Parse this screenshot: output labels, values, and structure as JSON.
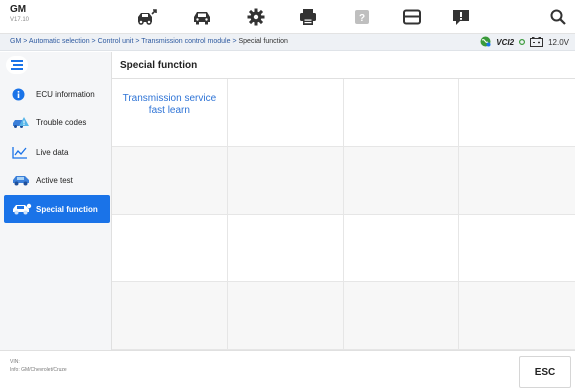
{
  "header": {
    "brand": "GM",
    "version": "V17.10",
    "tools": [
      {
        "name": "vehicle-diagnose-icon"
      },
      {
        "name": "car-icon"
      },
      {
        "name": "settings-gear-icon"
      },
      {
        "name": "printer-icon"
      },
      {
        "name": "help-icon"
      },
      {
        "name": "folder-icon"
      },
      {
        "name": "feedback-icon"
      },
      {
        "name": "search-icon"
      }
    ]
  },
  "breadcrumb": {
    "items": [
      "GM",
      "Automatic selection",
      "Control unit",
      "Transmission control module"
    ],
    "separator": ">",
    "current": "Special function"
  },
  "status": {
    "vci_label": "VCI2",
    "voltage": "12.0V"
  },
  "sidebar": {
    "items": [
      {
        "label": "ECU information",
        "icon": "info-icon",
        "active": false
      },
      {
        "label": "Trouble codes",
        "icon": "trouble-code-car-icon",
        "active": false
      },
      {
        "label": "Live data",
        "icon": "line-chart-icon",
        "active": false
      },
      {
        "label": "Active test",
        "icon": "car-test-icon",
        "active": false
      },
      {
        "label": "Special function",
        "icon": "special-function-car-icon",
        "active": true
      }
    ]
  },
  "main": {
    "title": "Special function",
    "functions": [
      "Transmission service fast learn"
    ]
  },
  "footer": {
    "vin_label": "VIN:",
    "info_label": "Info: GM/Chevrolet/Cruze",
    "esc_label": "ESC"
  },
  "colors": {
    "accent": "#1a73e8",
    "link": "#2f74d6",
    "breadcrumb": "#2e5aa0"
  }
}
